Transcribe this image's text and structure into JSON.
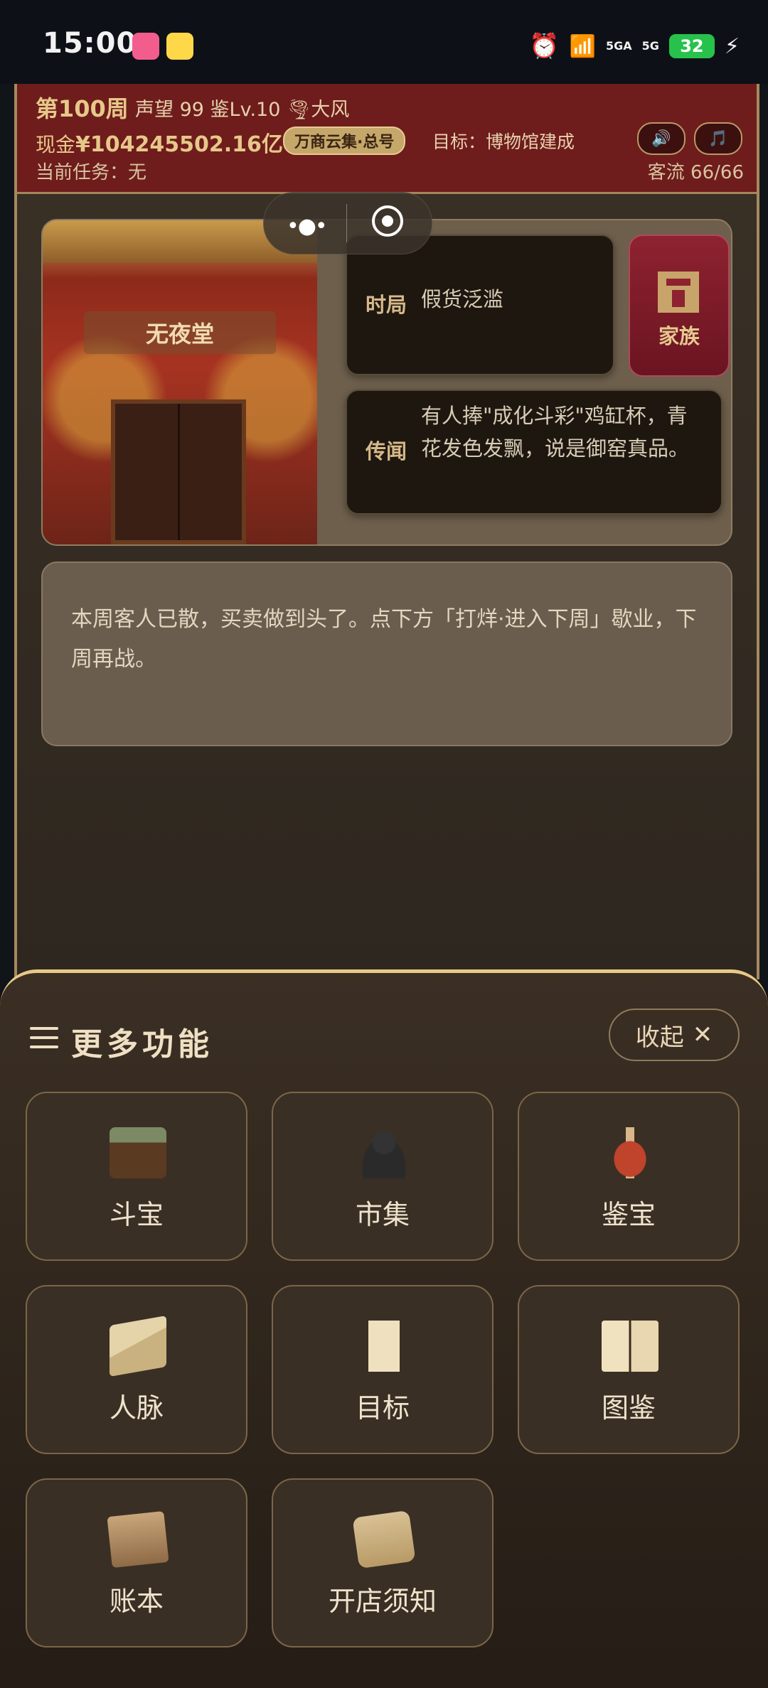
{
  "status_bar": {
    "time": "15:00",
    "signal1": "5GA",
    "signal2": "5G",
    "battery": "32"
  },
  "header": {
    "week": "第100周",
    "stats": "声望 99  鉴Lv.10  🌪大风",
    "cash_prefix": "现金",
    "cash_value": "¥104245502.16亿",
    "badge": "万商云集·总号",
    "goal": "目标：博物馆建成",
    "task": "当前任务：无",
    "customer_flow": "客流 66/66",
    "sound_icon": "🔊",
    "music_icon": "🎵"
  },
  "shop": {
    "name": "无夜堂"
  },
  "info": {
    "situation_label": "时局",
    "situation_value": "假货泛滥",
    "rumor_label": "传闻",
    "rumor_text": "有人捧\"成化斗彩\"鸡缸杯，青花发色发飘，说是御窑真品。",
    "family_label": "家族"
  },
  "message": {
    "text": "本周客人已散，买卖做到头了。点下方「打烊·进入下周」歇业，下周再战。"
  },
  "sheet": {
    "title": "更多功能",
    "collapse_label": "收起",
    "collapse_icon": "✕",
    "items": [
      {
        "label": "斗宝",
        "icon": "treasure-chest-icon"
      },
      {
        "label": "市集",
        "icon": "merchant-icon"
      },
      {
        "label": "鉴宝",
        "icon": "vase-icon"
      },
      {
        "label": "人脉",
        "icon": "letters-icon"
      },
      {
        "label": "目标",
        "icon": "scroll-icon"
      },
      {
        "label": "图鉴",
        "icon": "book-icon"
      },
      {
        "label": "账本",
        "icon": "ledger-icon"
      },
      {
        "label": "开店须知",
        "icon": "map-scroll-icon"
      }
    ]
  }
}
